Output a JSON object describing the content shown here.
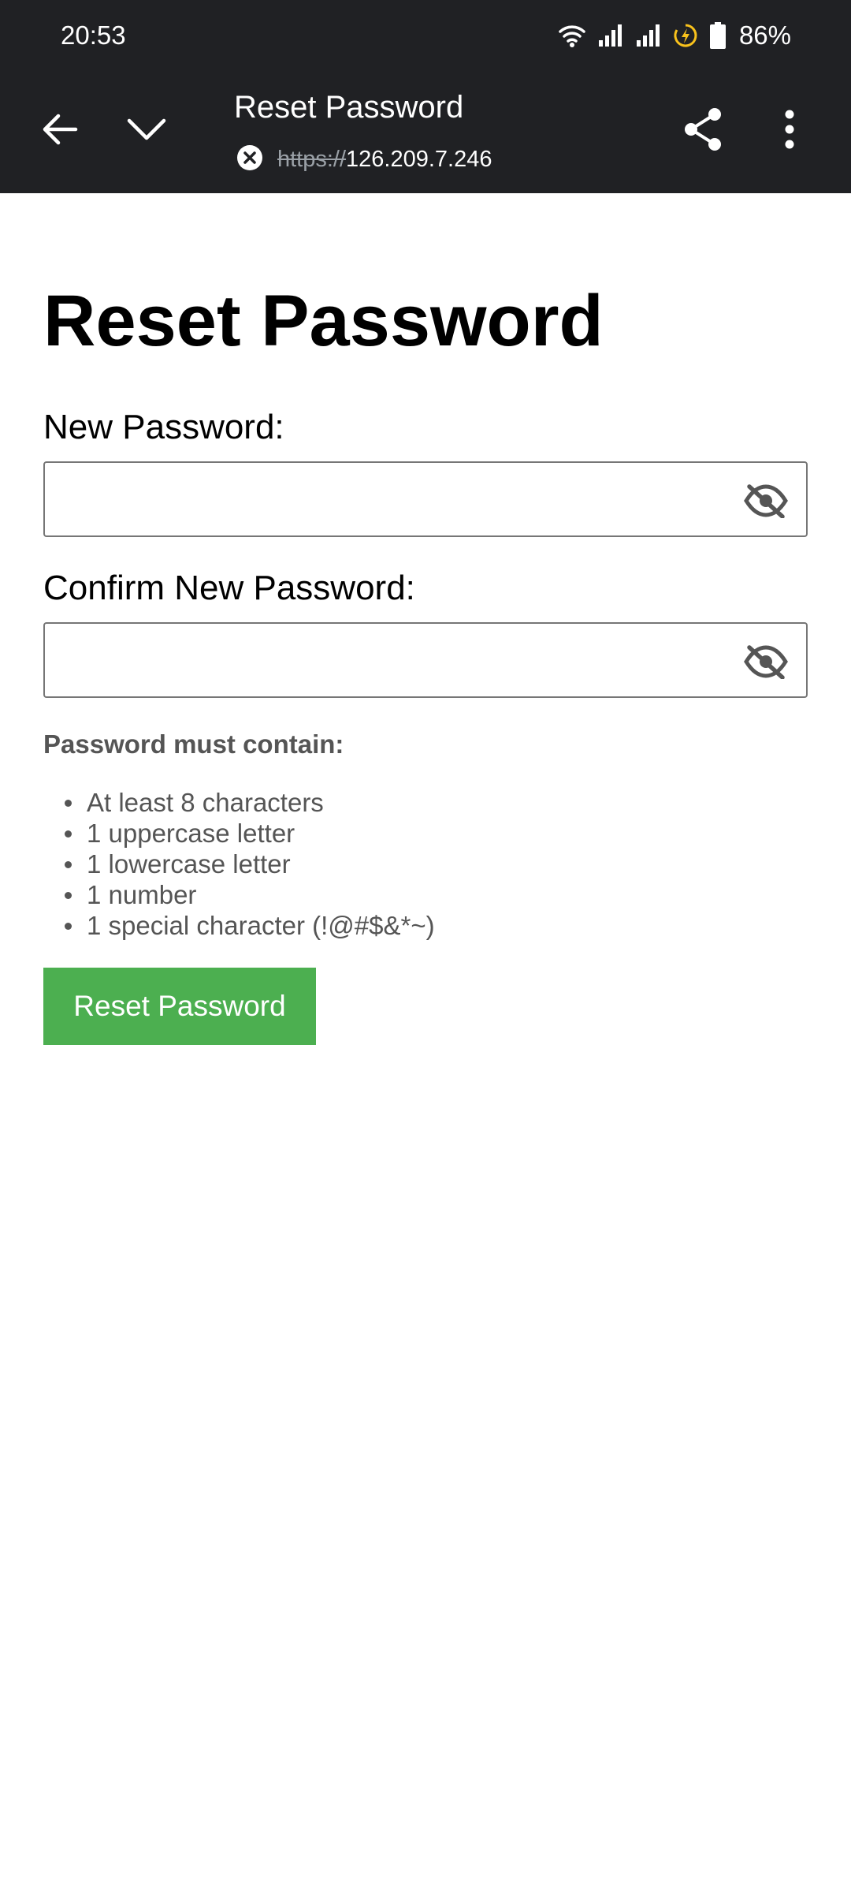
{
  "status_bar": {
    "time": "20:53",
    "battery_percent": "86%",
    "icons": [
      "wifi-icon",
      "signal-icon",
      "signal-icon",
      "battery-saver-icon",
      "battery-icon"
    ]
  },
  "browser": {
    "tab_title": "Reset Password",
    "url_scheme": "https://",
    "url_host": "126.209.7.246",
    "security_icon": "not-secure-icon",
    "actions": [
      "back-icon",
      "collapse-icon",
      "share-icon",
      "more-menu-icon"
    ]
  },
  "form": {
    "title": "Reset Password",
    "new_password_label": "New Password:",
    "new_password_value": "",
    "confirm_password_label": "Confirm New Password:",
    "confirm_password_value": "",
    "visibility_icon": "eye-off-icon",
    "requirements_heading": "Password must contain:",
    "requirements": [
      "At least 8 characters",
      "1 uppercase letter",
      "1 lowercase letter",
      "1 number",
      "1 special character (!@#$&*~)"
    ],
    "submit_label": "Reset Password"
  },
  "colors": {
    "chrome_background": "#202124",
    "button_green": "#4caf50",
    "helper_text": "#555555",
    "battery_saver": "#f9c21c"
  }
}
